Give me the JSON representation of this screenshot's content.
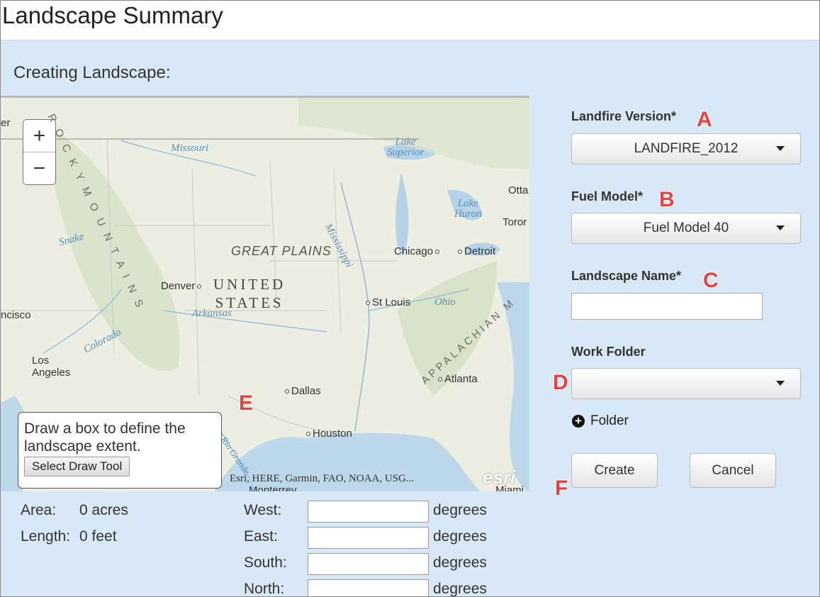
{
  "window": {
    "title": "Landscape Summary"
  },
  "panel": {
    "subtitle": "Creating Landscape:"
  },
  "map": {
    "zoom_in": "+",
    "zoom_out": "−",
    "labels": {
      "missouri": "Missouri",
      "lake_superior": "Lake\nSuperior",
      "lake_huron": "Lake\nHuron",
      "mississippi": "Mississippi",
      "snake": "Snake",
      "great_plains": "GREAT PLAINS",
      "united_states": "UNITED\nSTATES",
      "arkansas": "Arkansas",
      "colorado": "Colorado",
      "ohio": "Ohio",
      "rio_grande": "Rio Grande",
      "rocky": "R O C K Y   M O U N T A I N S",
      "appalachian": "APPALACHIAN M",
      "chicago": "Chicago",
      "detroit": "Detroit",
      "denver": "Denver",
      "st_louis": "St Louis",
      "atlanta": "Atlanta",
      "dallas": "Dallas",
      "houston": "Houston",
      "los_angeles": "Los\nAngeles",
      "francisco": "ncisco",
      "ottawa": "Otta",
      "toronto": "Toror",
      "monterrey": "Monterrey",
      "miami": "Miami",
      "er": "er"
    },
    "draw_box": {
      "message": "Draw a box to define the landscape extent.",
      "button": "Select Draw Tool"
    },
    "attribution": "Esri, HERE, Garmin, FAO, NOAA, USG...",
    "logo": "esri"
  },
  "stats": {
    "area_label": "Area:",
    "area_value": "0 acres",
    "length_label": "Length:",
    "length_value": "0 feet"
  },
  "bounds": {
    "unit": "degrees",
    "west_label": "West:",
    "east_label": "East:",
    "south_label": "South:",
    "north_label": "North:",
    "west_value": "",
    "east_value": "",
    "south_value": "",
    "north_value": ""
  },
  "form": {
    "landfire_label": "Landfire Version*",
    "landfire_value": "LANDFIRE_2012",
    "fuel_label": "Fuel Model*",
    "fuel_value": "Fuel Model 40",
    "name_label": "Landscape Name*",
    "name_value": "",
    "folder_label": "Work Folder",
    "folder_value": "",
    "add_folder": "Folder",
    "create": "Create",
    "cancel": "Cancel"
  },
  "annotations": {
    "a": "A",
    "b": "B",
    "c": "C",
    "d": "D",
    "e": "E",
    "f": "F",
    "color": "#e8413d"
  }
}
